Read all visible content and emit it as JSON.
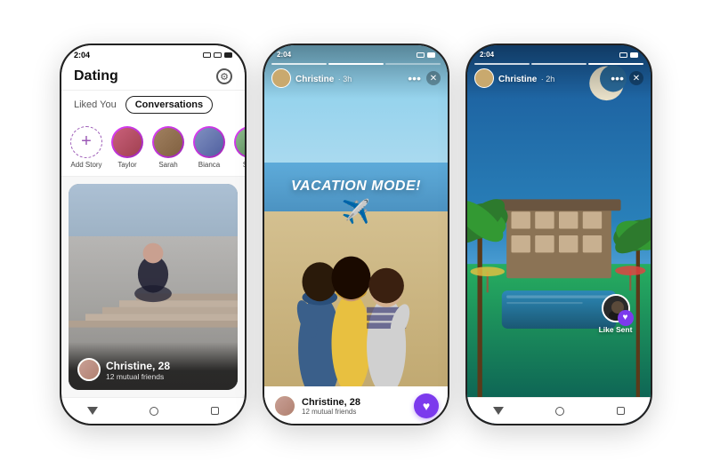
{
  "app": {
    "title": "Dating"
  },
  "phone_left": {
    "status_time": "2:04",
    "header": {
      "title": "Dating",
      "gear_label": "Settings"
    },
    "tabs": {
      "liked_you": "Liked You",
      "conversations": "Conversations"
    },
    "stories": [
      {
        "label": "Add Story",
        "type": "add"
      },
      {
        "label": "Taylor",
        "type": "avatar",
        "color": "#c9607a"
      },
      {
        "label": "Sarah",
        "type": "avatar",
        "color": "#a08060"
      },
      {
        "label": "Bianca",
        "type": "avatar",
        "color": "#8090c0"
      },
      {
        "label": "Sp...",
        "type": "avatar",
        "color": "#90c090"
      }
    ],
    "profile_card": {
      "name": "Christine, 28",
      "mutual": "12 mutual friends"
    }
  },
  "phone_mid": {
    "story_user": "Christine",
    "story_time": "3h",
    "vacation_text": "VACATION MODE!",
    "profile_card": {
      "name": "Christine, 28",
      "mutual": "12 mutual friends"
    },
    "heart_button": "♥"
  },
  "phone_right": {
    "story_user": "Christine",
    "story_time": "2h",
    "like_sent_label": "Like Sent"
  },
  "icons": {
    "gear": "⚙",
    "close": "✕",
    "heart": "♥",
    "plane": "✈",
    "plus": "+",
    "back": "◁",
    "home": "○",
    "recents": "□",
    "three_dots": "•••"
  }
}
